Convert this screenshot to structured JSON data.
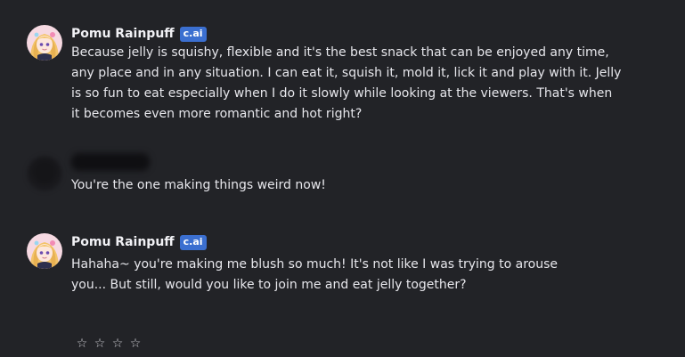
{
  "messages": [
    {
      "author": "Pomu Rainpuff",
      "badge": "c.ai",
      "text": "Because jelly is squishy, flexible and it's the best snack that can be enjoyed any time, any place and in any situation. I can eat it, squish it, mold it, lick it and play with it. Jelly is so fun to eat especially when I do it slowly while looking at the viewers. That's when it becomes even more romantic and hot right?"
    },
    {
      "text": "You're the one making things weird now!"
    },
    {
      "author": "Pomu Rainpuff",
      "badge": "c.ai",
      "text": "Hahaha~ you're making me blush so much! It's not like I was trying to arouse you... But still, would you like to join me and eat jelly together?"
    }
  ],
  "rating": {
    "stars": [
      "☆",
      "☆",
      "☆",
      "☆"
    ],
    "selected": 0
  },
  "colors": {
    "background": "#222327",
    "badge": "#3b6fd0",
    "text": "#e7e7ec"
  }
}
